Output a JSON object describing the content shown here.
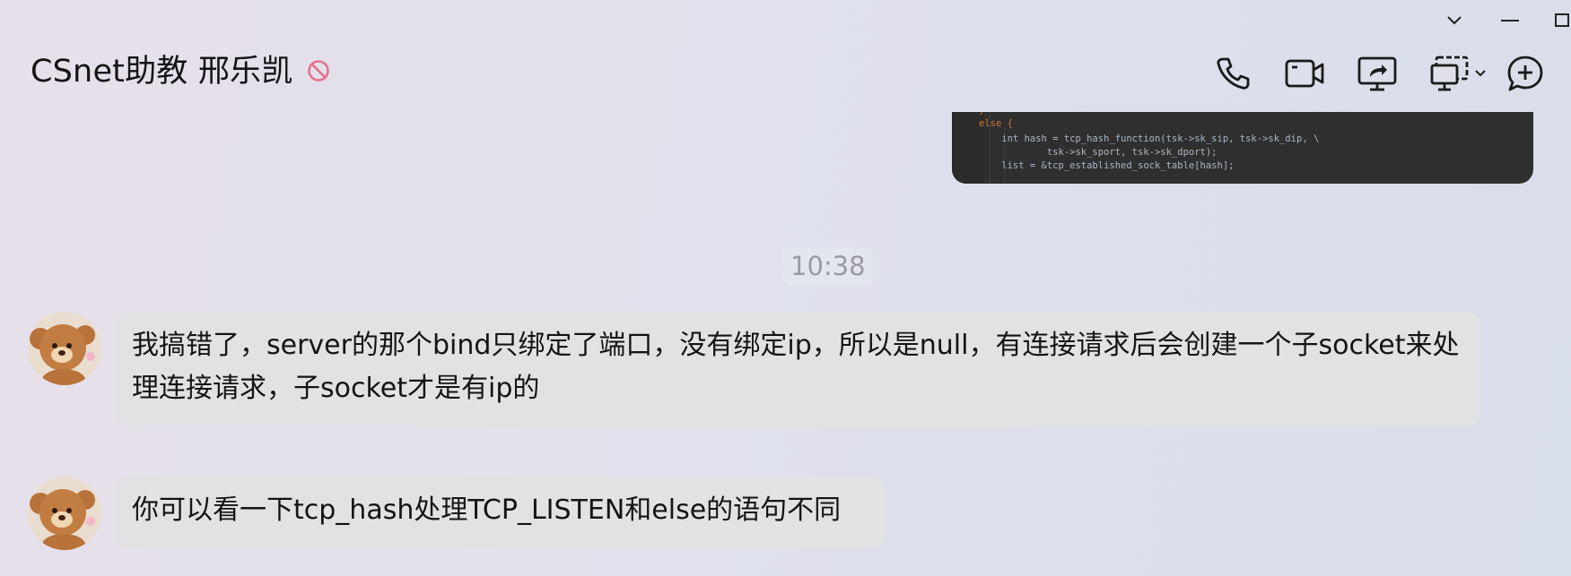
{
  "header": {
    "title": "CSnet助教 邢乐凯",
    "status_icon": "do-not-disturb-icon",
    "tools": [
      {
        "name": "voice-call-icon"
      },
      {
        "name": "video-call-icon"
      },
      {
        "name": "screen-share-icon"
      },
      {
        "name": "remote-assist-icon"
      },
      {
        "name": "add-member-icon"
      }
    ]
  },
  "window_controls": [
    "collapse-icon",
    "minimize-icon",
    "maximize-icon"
  ],
  "code_image": {
    "lines": [
      "}",
      "else {",
      "    int hash = tcp_hash_function(tsk->sk_sip, tsk->sk_dip, \\",
      "            tsk->sk_sport, tsk->sk_dport);",
      "    list = &tcp_established_sock_table[hash];"
    ]
  },
  "timestamp": "10:38",
  "messages": [
    {
      "text": "我搞错了，server的那个bind只绑定了端口，没有绑定ip，所以是null，有连接请求后会创建一个子socket来处理连接请求，子socket才是有ip的"
    },
    {
      "text": "你可以看一下tcp_hash处理TCP_LISTEN和else的语句不同"
    }
  ],
  "colors": {
    "bubble": "#e2e2e4",
    "dnd": "#e8708c",
    "code_bg": "#2f2f30"
  }
}
